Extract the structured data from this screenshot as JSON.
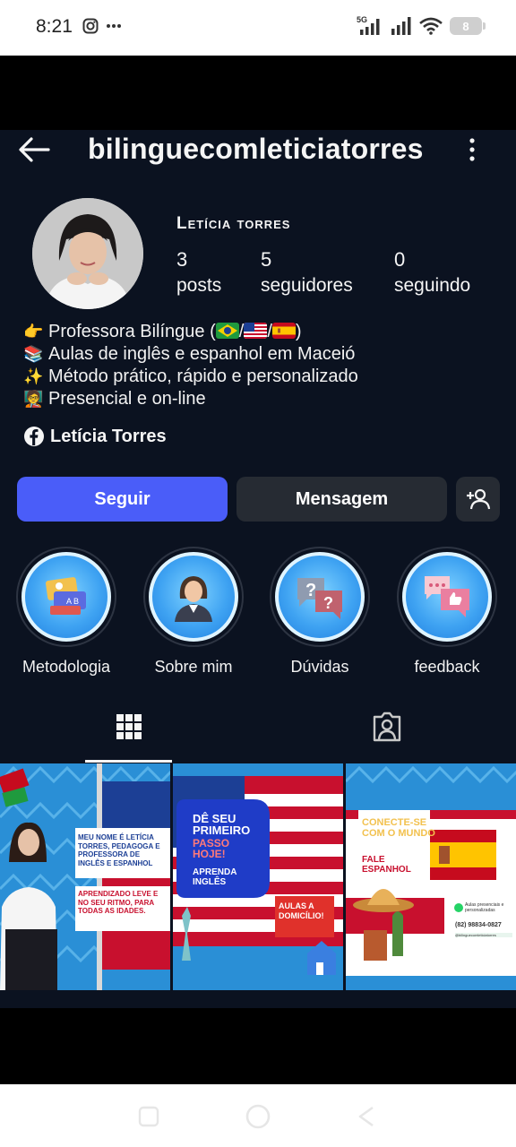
{
  "status_bar": {
    "time": "8:21",
    "left_icons": [
      "instagram-icon",
      "more-dots-icon"
    ],
    "right_icons": [
      "5g-signal-icon",
      "signal-icon",
      "wifi-icon"
    ],
    "battery": "8"
  },
  "header": {
    "username": "bilinguecomleticiatorres",
    "back_icon": "arrow-left-icon",
    "more_icon": "vertical-dots-icon"
  },
  "profile": {
    "full_name": "Letícia torres",
    "stats": [
      {
        "value": "3",
        "label": "posts"
      },
      {
        "value": "5",
        "label": "seguidores"
      },
      {
        "value": "0",
        "label": "seguindo"
      }
    ],
    "bio": {
      "line1_prefix": "Professora Bilíngue (",
      "line1_sep1": "/",
      "line1_sep2": "/",
      "line1_suffix": ")",
      "line2": "Aulas de inglês e espanhol em Maceió",
      "line3": "Método prático, rápido e personalizado",
      "line4": "Presencial e on-line"
    },
    "facebook_link": "Letícia Torres"
  },
  "actions": {
    "follow": "Seguir",
    "message": "Mensagem",
    "add_user_icon": "add-user-icon"
  },
  "highlights": [
    {
      "label": "Metodologia",
      "icon": "books-icon"
    },
    {
      "label": "Sobre mim",
      "icon": "woman-icon"
    },
    {
      "label": "Dúvidas",
      "icon": "question-bubbles-icon"
    },
    {
      "label": "feedback",
      "icon": "feedback-bubbles-icon"
    }
  ],
  "tabs": [
    {
      "name": "grid",
      "icon": "grid-icon",
      "active": true
    },
    {
      "name": "tagged",
      "icon": "tagged-person-icon",
      "active": false
    }
  ],
  "posts": [
    {
      "text1": "MEU NOME É LETÍCIA TORRES, PEDAGOGA E PROFESSORA DE INGLÊS E ESPANHOL",
      "text2": "APRENDIZADO LEVE E NO SEU RITMO, PARA TODAS AS IDADES."
    },
    {
      "title1": "DÊ SEU PRIMEIRO",
      "title2": "PASSO HOJE!",
      "subtitle": "APRENDA INGLÊS",
      "badge": "AULAS A DOMICÍLIO!"
    },
    {
      "title": "CONECTE-SE COM O MUNDO",
      "subtitle": "FALE ESPANHOL",
      "contact_note": "Aulas presenciais e personalizadas",
      "phone": "(82) 98834-0827",
      "handle": "@bilinguecomleticiatorres"
    }
  ],
  "colors": {
    "background": "#0b1220",
    "follow_button": "#4a5df9",
    "secondary_button": "#262b33"
  }
}
